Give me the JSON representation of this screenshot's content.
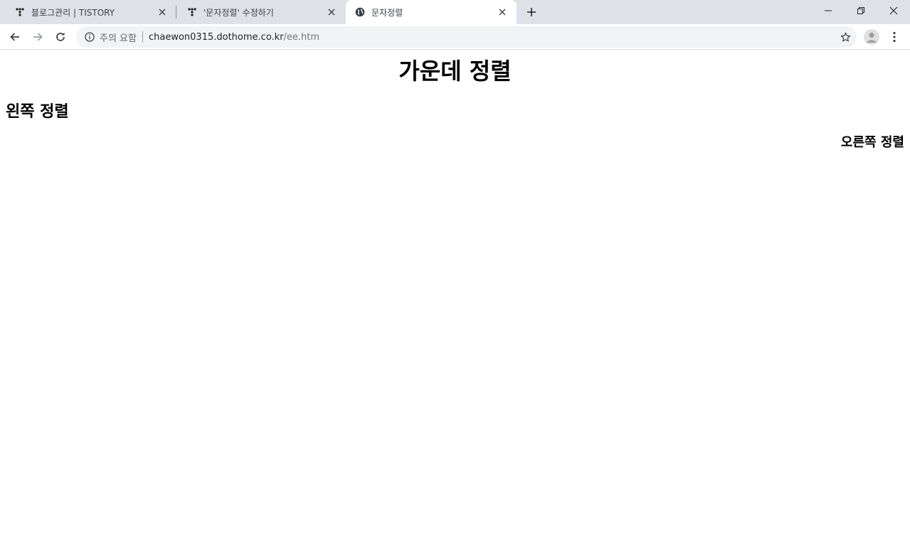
{
  "browser": {
    "tabs": [
      {
        "title": "블로그관리 | TISTORY",
        "favicon": "tistory-icon",
        "active": false
      },
      {
        "title": "'문자정렬' 수정하기",
        "favicon": "tistory-icon",
        "active": false
      },
      {
        "title": "문자정렬",
        "favicon": "globe-icon",
        "active": true
      }
    ],
    "new_tab_icon": "plus-icon",
    "window_controls": [
      "minimize-icon",
      "restore-icon",
      "close-icon"
    ]
  },
  "toolbar": {
    "security_label": "주의 요함",
    "url_host": "chaewon0315.dothome.co.kr",
    "url_path": "/ee.htm"
  },
  "page": {
    "heading_center": "가운데 정렬",
    "heading_left": "왼쪽 정렬",
    "heading_right": "오른쪽 정렬"
  },
  "colors": {
    "tabstrip_bg": "#dee1e6",
    "active_tab_bg": "#ffffff",
    "omnibox_bg": "#f1f3f4"
  }
}
